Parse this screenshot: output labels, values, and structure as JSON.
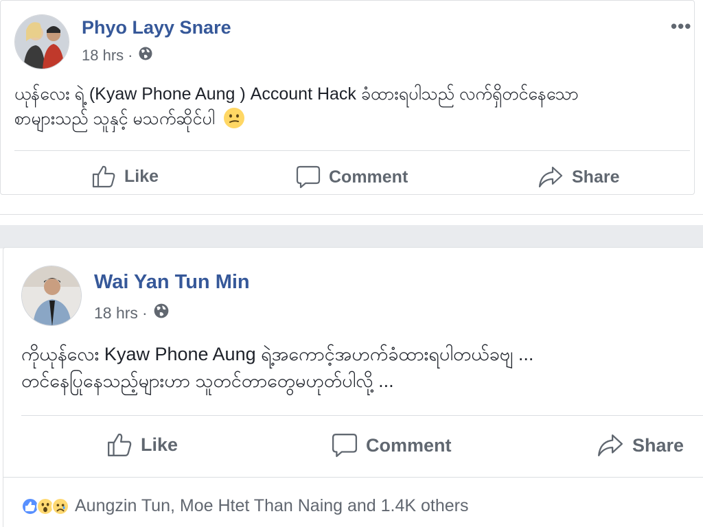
{
  "posts": [
    {
      "author": "Phyo Layy Snare",
      "time": "18 hrs",
      "separator": "·",
      "privacy_icon": "globe-icon",
      "more_icon": "more-options-icon",
      "more_label": "•••",
      "text_line1": "ယုန်လေး ရဲ့ (Kyaw Phone Aung ) Account Hack ခံထားရပါသည် လက်ရှိတင်နေသော",
      "text_line2": "စာများသည် သူနှင့် မသက်ဆိုင်ပါ",
      "emoji": "confused-face-emoji",
      "actions": {
        "like": "Like",
        "comment": "Comment",
        "share": "Share"
      }
    },
    {
      "author": "Wai Yan Tun Min",
      "time": "18 hrs",
      "separator": "·",
      "privacy_icon": "globe-icon",
      "text_line1": "ကိုယုန်လေး Kyaw Phone Aung ရဲ့အကောင့်အဟက်ခံထားရပါတယ်ခဗျ ...",
      "text_line2": "တင်နေပြုနေသည့်များဟာ သူတင်တာတွေမဟုတ်ပါလို့ ...",
      "actions": {
        "like": "Like",
        "comment": "Comment",
        "share": "Share"
      },
      "reactions": {
        "icons": [
          "like-reaction-icon",
          "wow-reaction-icon",
          "sad-reaction-icon"
        ],
        "summary": "Aungzin Tun, Moe Htet Than Naing and 1.4K others"
      }
    }
  ],
  "colors": {
    "author_blue": "#365899",
    "meta_gray": "#616770",
    "action_gray": "#606770",
    "separator_band": "#e9ebee",
    "like_blue": "#5890ff",
    "emoji_yellow": "#ffd764"
  }
}
